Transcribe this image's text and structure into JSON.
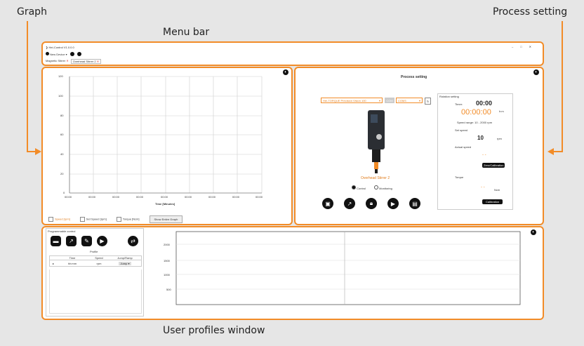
{
  "callouts": {
    "graph": "Graph",
    "process": "Process setting",
    "menu": "Menu bar",
    "profiles": "User profiles window"
  },
  "menubar": {
    "app_title": "Hei-Control V1.0.0.0",
    "new_device": "New Device",
    "tab_magnetic": "Magnetic Stirrer",
    "tab_overhead": "Overhead Stirrer 2",
    "win_controls": [
      "–",
      "□",
      "✕"
    ]
  },
  "graph": {
    "y_ticks": [
      "120",
      "100",
      "80",
      "60",
      "40",
      "20",
      "0"
    ],
    "x_ticks": [
      "00:00",
      "00:00",
      "00:00",
      "00:00",
      "00:00",
      "00:00",
      "00:00",
      "00:00",
      "00:00"
    ],
    "x_label": "Time [Minutes]",
    "legend": {
      "speed": "Speed [rpm]",
      "set_speed": "Set Speed [rpm]",
      "torque": "Torque [Ncm]",
      "show_graph": "Show Entire Graph"
    }
  },
  "process": {
    "title": "Process setting",
    "device_select": "Hei-TORQUE Precision Vision 100",
    "port_label": "COM",
    "port_value": "COM3",
    "device_name": "Overhead Stirrer 2",
    "radio_control": "Control",
    "radio_monitoring": "Monitoring",
    "rotation_setting": "Rotation setting",
    "timer_label": "Timer:",
    "timer_set": "00:00",
    "timer_run": "00:00:00",
    "timer_unit": "h:m",
    "speed_range": "Speed range: 10 - 2000 rpm",
    "set_speed_label": "Set speed",
    "set_speed_value": "10",
    "set_speed_unit": "rpm",
    "actual_speed_label": "Actual speed",
    "actual_speed_value": "- -",
    "zero_btn": "Zero/Calibration",
    "torque_label": "Torque",
    "torque_value": "- -",
    "torque_unit": "Ncm",
    "calibration_btn": "Calibration"
  },
  "profiles": {
    "title": "Programmable control",
    "table_title": "Profile",
    "headers": [
      "Time",
      "Speed",
      "Jump/Ramp"
    ],
    "row": {
      "time": "hh:mm",
      "speed": "rpm",
      "mode": "Jump"
    },
    "y_ticks": [
      "2000",
      "1500",
      "1000",
      "500"
    ]
  },
  "colors": {
    "accent": "#f28c28",
    "dark": "#111111"
  }
}
